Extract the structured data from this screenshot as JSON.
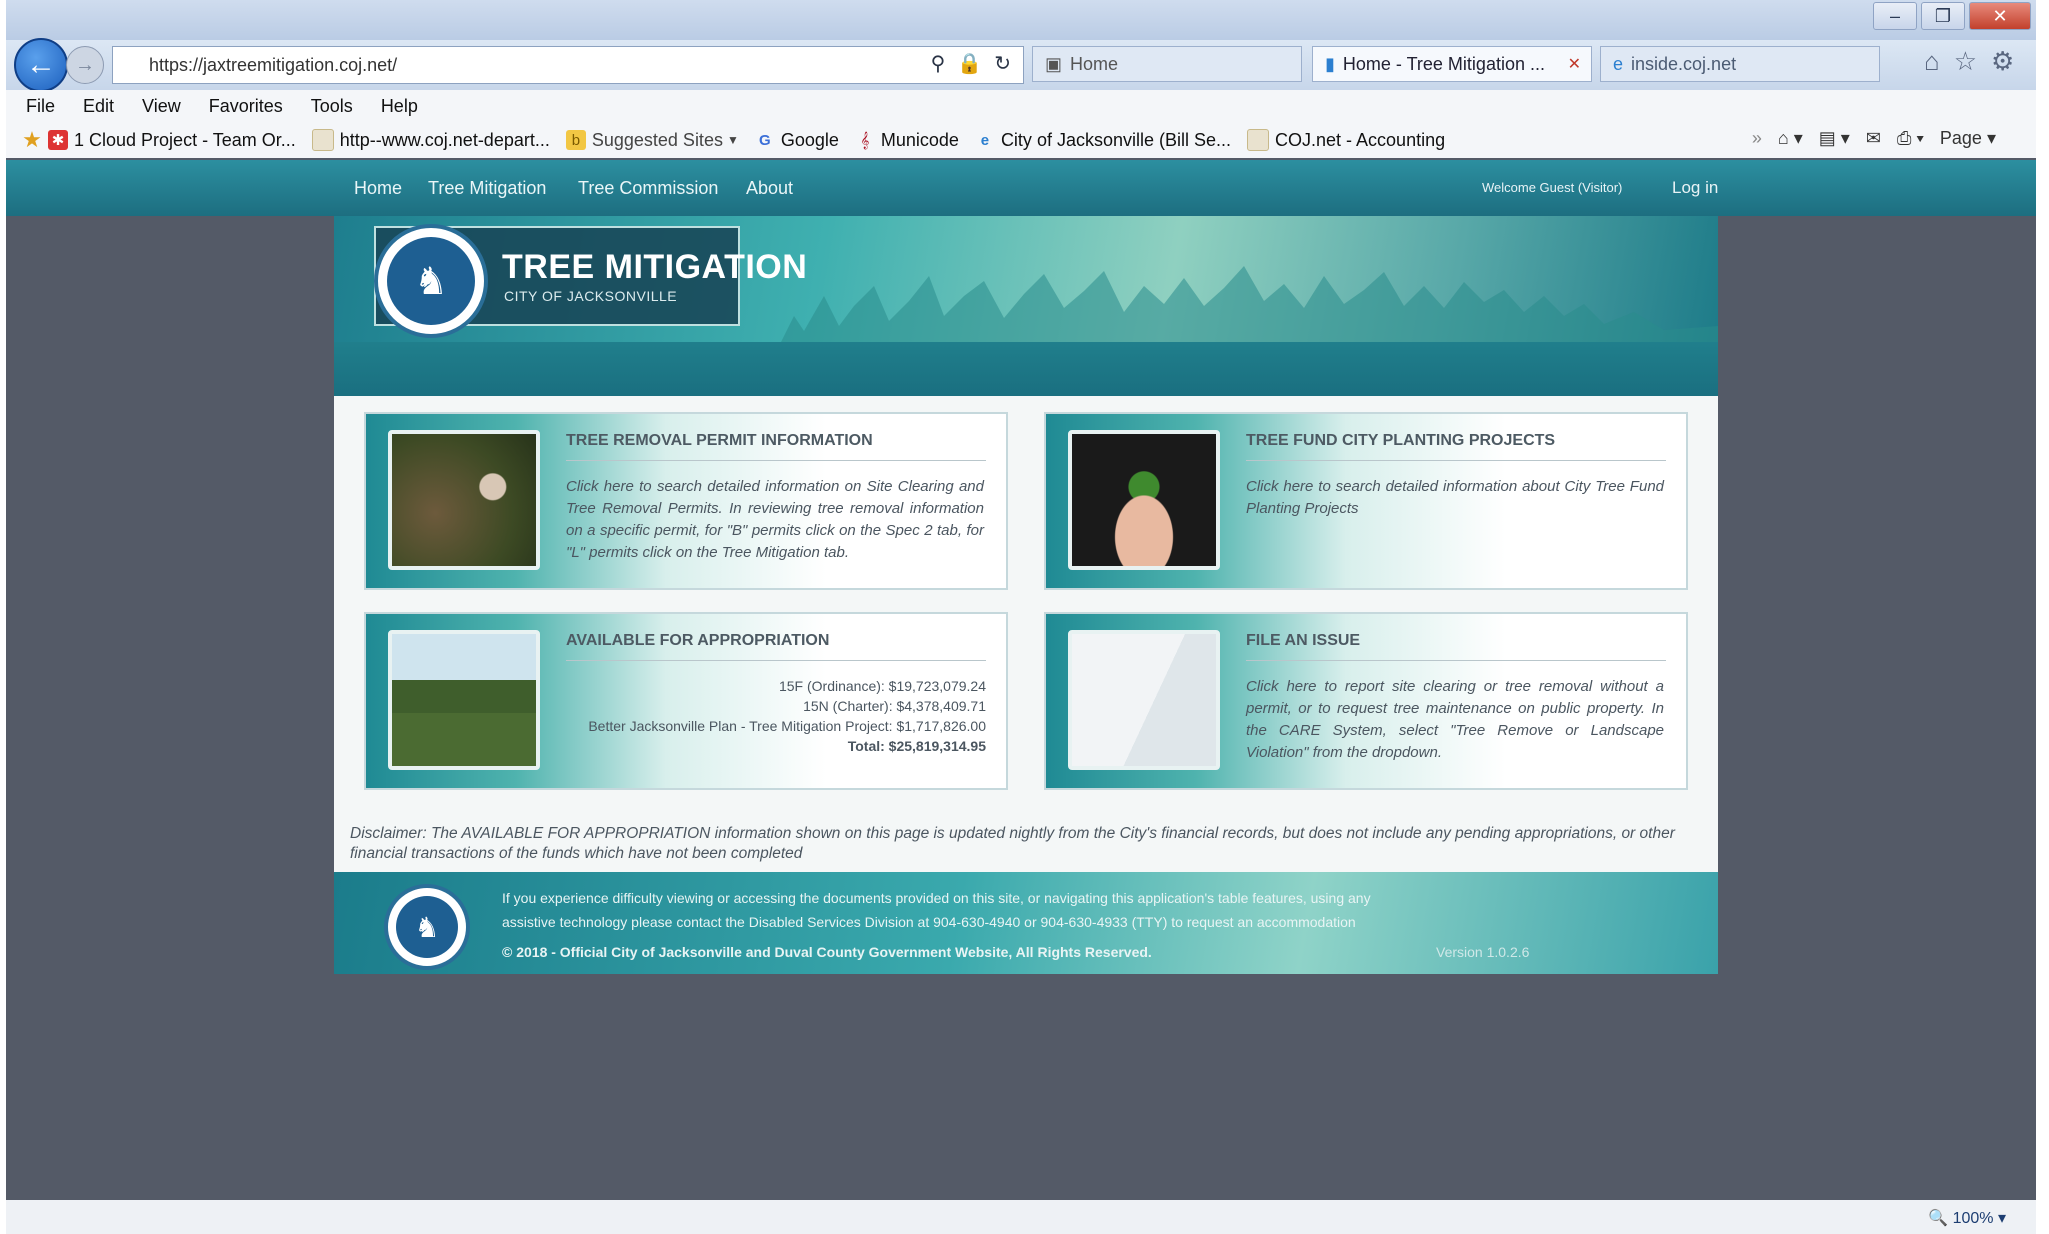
{
  "browser": {
    "url": "https://jaxtreemitigation.coj.net/",
    "tabs": [
      {
        "label": "Home"
      },
      {
        "label": "Home - Tree Mitigation ..."
      },
      {
        "label": "inside.coj.net"
      }
    ],
    "menu": [
      "File",
      "Edit",
      "View",
      "Favorites",
      "Tools",
      "Help"
    ],
    "favorites": [
      {
        "label": "1 Cloud Project - Team Or..."
      },
      {
        "label": "http--www.coj.net-depart..."
      },
      {
        "label": "Suggested Sites"
      },
      {
        "label": "Google"
      },
      {
        "label": "Municode"
      },
      {
        "label": "City of Jacksonville (Bill Se..."
      },
      {
        "label": "COJ.net - Accounting"
      }
    ],
    "page_menu": "Page",
    "zoom": "100%"
  },
  "site": {
    "nav": [
      "Home",
      "Tree Mitigation",
      "Tree Commission",
      "About"
    ],
    "welcome": "Welcome Guest (Visitor)",
    "login": "Log in",
    "title": "TREE MITIGATION",
    "subtitle": "CITY OF JACKSONVILLE",
    "cards": {
      "removal": {
        "title": "TREE REMOVAL PERMIT INFORMATION",
        "body": "Click here to search detailed information on Site Clearing and Tree Removal Permits. In reviewing tree removal information on a specific permit, for \"B\" permits click on the Spec 2 tab, for \"L\" permits click on the Tree Mitigation tab."
      },
      "fund": {
        "title": "TREE FUND CITY PLANTING PROJECTS",
        "body": "Click here to search detailed information about City Tree Fund Planting Projects"
      },
      "appropriation": {
        "title": "AVAILABLE FOR APPROPRIATION",
        "rows": [
          "15F (Ordinance): $19,723,079.24",
          "15N (Charter): $4,378,409.71",
          "Better Jacksonville Plan - Tree Mitigation Project: $1,717,826.00",
          "Total: $25,819,314.95"
        ]
      },
      "issue": {
        "title": "FILE AN ISSUE",
        "body": "Click here to report site clearing or tree removal without a permit, or to request tree maintenance on public property. In the CARE System, select \"Tree Remove or Landscape Violation\" from the dropdown."
      }
    },
    "disclaimer": "Disclaimer: The AVAILABLE FOR APPROPRIATION information shown on this page is updated nightly from the City's financial records, but does not include any pending appropriations, or other financial transactions of the funds which have not been completed",
    "footer": {
      "line1": "If you experience difficulty viewing or accessing the documents provided on this site, or navigating this application's table features, using any",
      "line2": "assistive technology please contact the Disabled Services Division at 904-630-4940 or 904-630-4933 (TTY) to request an accommodation",
      "copyright": "© 2018 - Official City of Jacksonville and Duval County Government Website, All Rights Reserved.",
      "version": "Version 1.0.2.6"
    }
  }
}
